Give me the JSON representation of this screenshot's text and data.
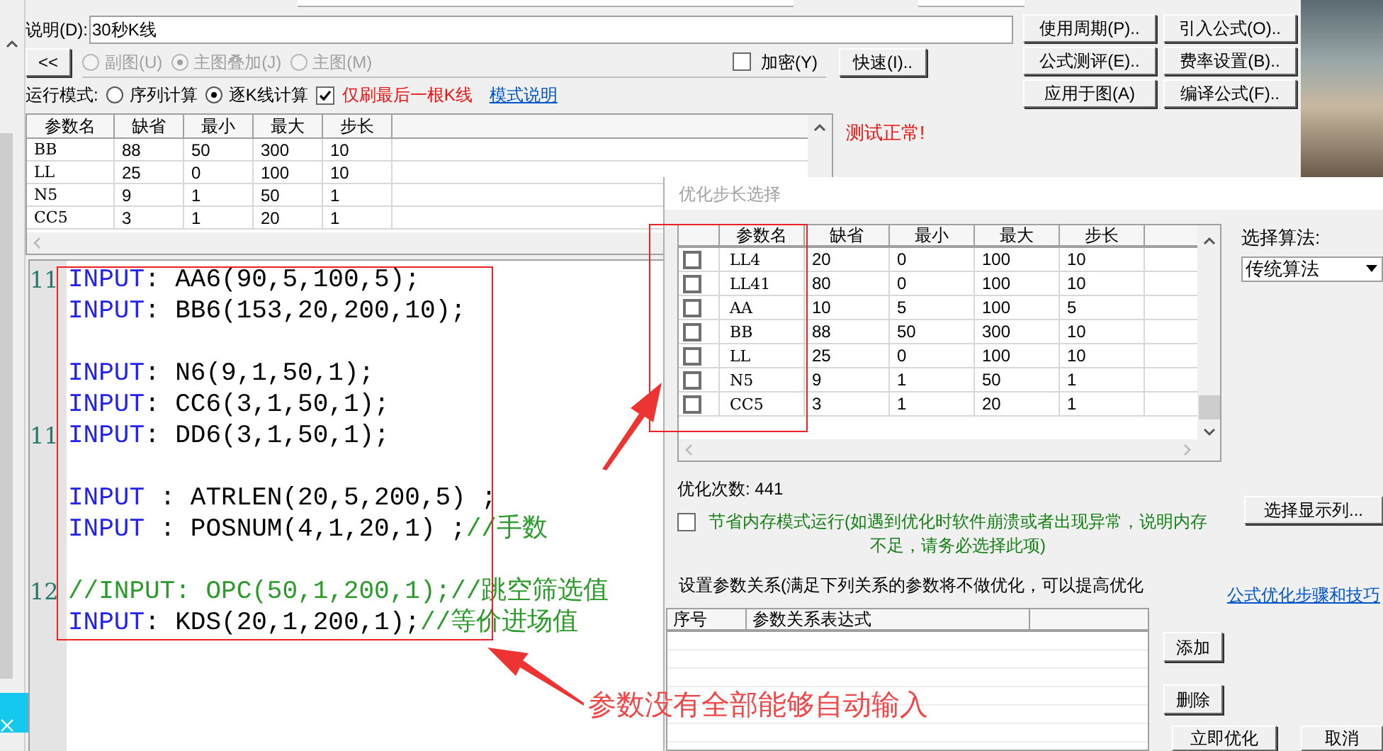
{
  "formula": {
    "description_label": "说明(D):",
    "description": "30秒K线",
    "collapse_button": "<<",
    "chart_types": [
      {
        "label": "副图(U)",
        "selected": false,
        "disabled": true
      },
      {
        "label": "主图叠加(J)",
        "selected": true,
        "disabled": true
      },
      {
        "label": "主图(M)",
        "selected": false,
        "disabled": true
      }
    ],
    "encrypt": {
      "label": "加密(Y)",
      "checked": false
    },
    "fast_button": "快速(I)..",
    "run_mode_label": "运行模式:",
    "run_modes": [
      {
        "label": "序列计算",
        "selected": false
      },
      {
        "label": "逐K线计算",
        "selected": true
      }
    ],
    "refresh_last": {
      "label": "仅刷最后一根K线",
      "checked": true
    },
    "mode_link": "模式说明",
    "side_buttons": [
      "使用周期(P)..",
      "引入公式(O)..",
      "公式测评(E)..",
      "费率设置(B)..",
      "应用于图(A)",
      "编译公式(F).."
    ],
    "params_table": {
      "columns": [
        "参数名",
        "缺省",
        "最小",
        "最大",
        "步长"
      ],
      "rows": [
        [
          "BB",
          "88",
          "50",
          "300",
          "10"
        ],
        [
          "LL",
          "25",
          "0",
          "100",
          "10"
        ],
        [
          "N5",
          "9",
          "1",
          "50",
          "1"
        ],
        [
          "CC5",
          "3",
          "1",
          "20",
          "1"
        ]
      ]
    },
    "test_status": "测试正常!",
    "code_lines": [
      {
        "kind": "input",
        "gutter": "11",
        "keyword": "INPUT",
        "code": ": AA6(90,5,100,5);"
      },
      {
        "kind": "input",
        "keyword": "INPUT",
        "code": ": BB6(153,20,200,10);"
      },
      {
        "kind": "blank"
      },
      {
        "kind": "input",
        "keyword": "INPUT",
        "code": ": N6(9,1,50,1);"
      },
      {
        "kind": "input",
        "keyword": "INPUT",
        "code": ": CC6(3,1,50,1);"
      },
      {
        "kind": "input",
        "gutter": "11",
        "keyword": "INPUT",
        "code": ": DD6(3,1,50,1);"
      },
      {
        "kind": "blank"
      },
      {
        "kind": "input",
        "keyword": "INPUT",
        "code": " : ATRLEN(20,5,200,5) ;"
      },
      {
        "kind": "input",
        "keyword": "INPUT",
        "code": " : POSNUM(4,1,20,1) ;",
        "comment": "//手数"
      },
      {
        "kind": "blank"
      },
      {
        "kind": "comment",
        "gutter": "12",
        "code": "//INPUT: OPC(50,1,200,1);//跳空筛选值"
      },
      {
        "kind": "input",
        "keyword": "INPUT",
        "code": ": KDS(20,1,200,1);",
        "comment": "//等价进场值"
      }
    ]
  },
  "dialog": {
    "title": "优化步长选择",
    "params_table": {
      "columns": [
        "参数名",
        "缺省",
        "最小",
        "最大",
        "步长"
      ],
      "rows": [
        {
          "checked": false,
          "cells": [
            "LL4",
            "20",
            "0",
            "100",
            "10"
          ]
        },
        {
          "checked": false,
          "cells": [
            "LL41",
            "80",
            "0",
            "100",
            "10"
          ]
        },
        {
          "checked": false,
          "cells": [
            "AA",
            "10",
            "5",
            "100",
            "5"
          ]
        },
        {
          "checked": false,
          "cells": [
            "BB",
            "88",
            "50",
            "300",
            "10"
          ]
        },
        {
          "checked": false,
          "cells": [
            "LL",
            "25",
            "0",
            "100",
            "10"
          ]
        },
        {
          "checked": false,
          "cells": [
            "N5",
            "9",
            "1",
            "50",
            "1"
          ]
        },
        {
          "checked": false,
          "cells": [
            "CC5",
            "3",
            "1",
            "20",
            "1"
          ]
        }
      ]
    },
    "algorithm_label": "选择算法:",
    "algorithm": "传统算法",
    "count": "优化次数: 441",
    "save_memory": {
      "checked": false,
      "label": "节省内存模式运行(如遇到优化时软件崩溃或者出现异常，说明内存不足，请务必选择此项)"
    },
    "columns_button": "选择显示列...",
    "relation_label": "设置参数关系(满足下列关系的参数将不做优化，可以提高优化",
    "tips_link": "公式优化步骤和技巧",
    "relation_table": {
      "columns": [
        "序号",
        "参数关系表达式"
      ]
    },
    "add_button": "添加",
    "delete_button": "删除",
    "optimize_button": "立即优化",
    "cancel_button": "取消"
  },
  "annotation": {
    "text": "参数没有全部能够自动输入"
  }
}
